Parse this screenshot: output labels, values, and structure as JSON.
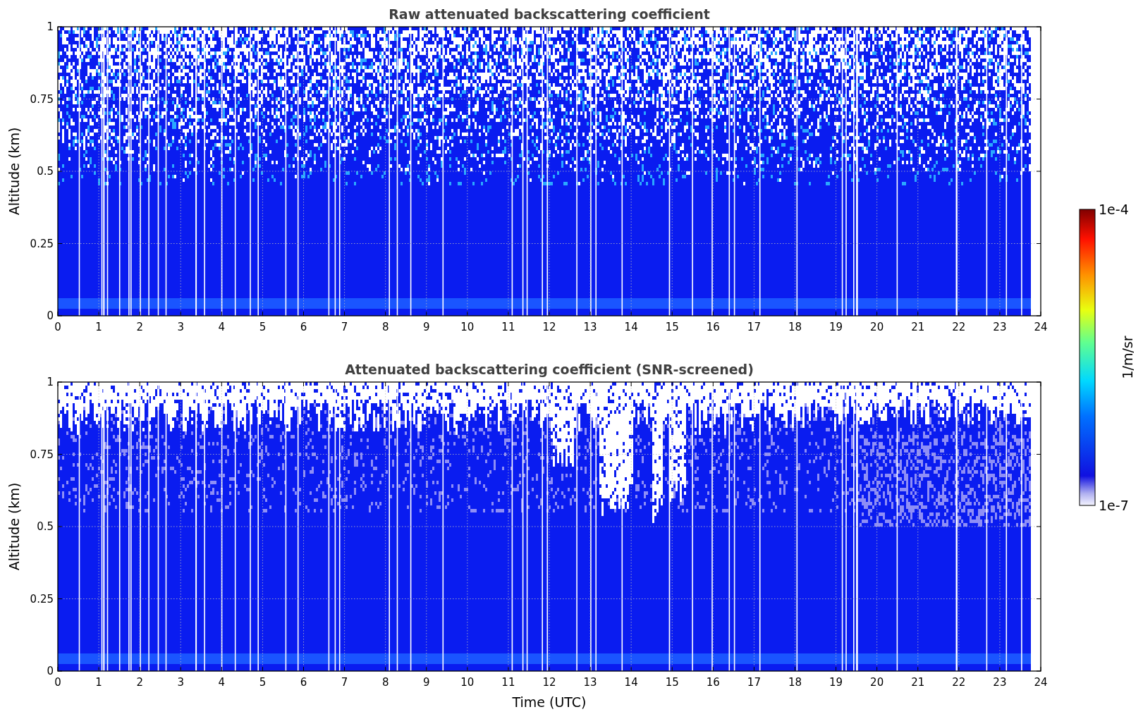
{
  "plots": [
    {
      "kind": "raw",
      "title": "Raw attenuated backscattering coefficient",
      "ylabel": "Altitude (km)",
      "yticks": [
        "1",
        "0.75",
        "0.5",
        "0.25",
        "0"
      ],
      "xticks": [
        "0",
        "1",
        "2",
        "3",
        "4",
        "5",
        "6",
        "7",
        "8",
        "9",
        "10",
        "11",
        "12",
        "13",
        "14",
        "15",
        "16",
        "17",
        "18",
        "19",
        "20",
        "21",
        "22",
        "23",
        "24"
      ]
    },
    {
      "kind": "screened",
      "title": "Attenuated backscattering coefficient (SNR-screened)",
      "ylabel": "Altitude (km)",
      "xlabel": "Time (UTC)",
      "yticks": [
        "1",
        "0.75",
        "0.5",
        "0.25",
        "0"
      ],
      "xticks": [
        "0",
        "1",
        "2",
        "3",
        "4",
        "5",
        "6",
        "7",
        "8",
        "9",
        "10",
        "11",
        "12",
        "13",
        "14",
        "15",
        "16",
        "17",
        "18",
        "19",
        "20",
        "21",
        "22",
        "23",
        "24"
      ]
    }
  ],
  "colorbar": {
    "label": "1/m/sr",
    "max_label": "1e-4",
    "min_label": "1e-7"
  }
}
